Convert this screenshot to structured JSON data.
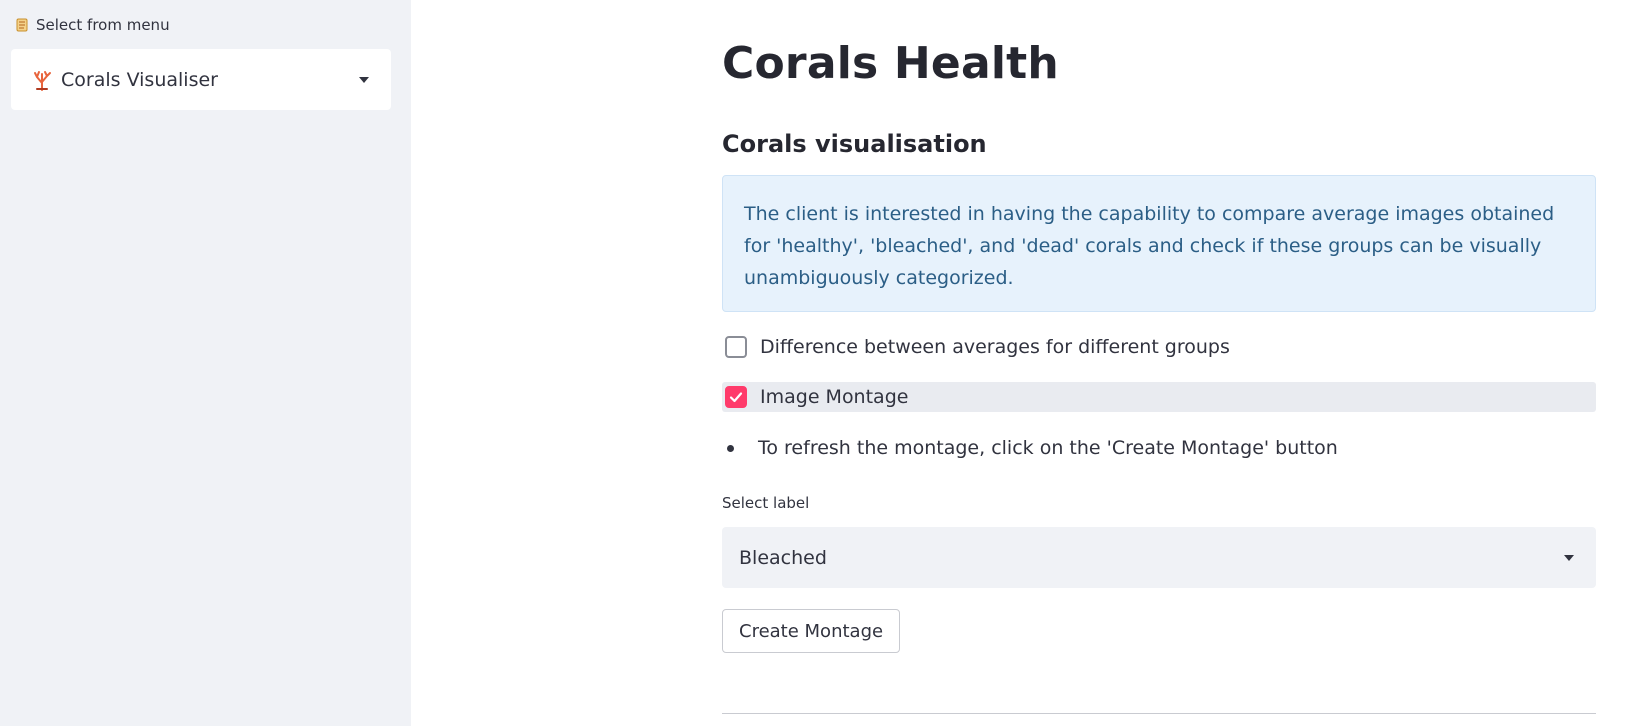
{
  "sidebar": {
    "header_icon": "scroll-icon",
    "header_label": "Select from menu",
    "menu_select": {
      "icon": "coral-icon",
      "value": "Corals Visualiser"
    }
  },
  "main": {
    "title": "Corals Health",
    "section_title": "Corals visualisation",
    "info_text": "The client is interested in having the capability to compare average images obtained for 'healthy', 'bleached', and 'dead' corals and check if these groups can be visually unambiguously categorized.",
    "checkboxes": [
      {
        "label": "Difference between averages for different groups",
        "checked": false
      },
      {
        "label": "Image Montage",
        "checked": true
      }
    ],
    "bullet_text": "To refresh the montage, click on the 'Create Montage' button",
    "select_label": "Select label",
    "select_value": "Bleached",
    "create_button_label": "Create Montage"
  },
  "colors": {
    "sidebar_bg": "#f0f2f6",
    "info_bg": "#e7f2fc",
    "info_text": "#2b5e86",
    "checkbox_accent": "#ff3b6b"
  }
}
